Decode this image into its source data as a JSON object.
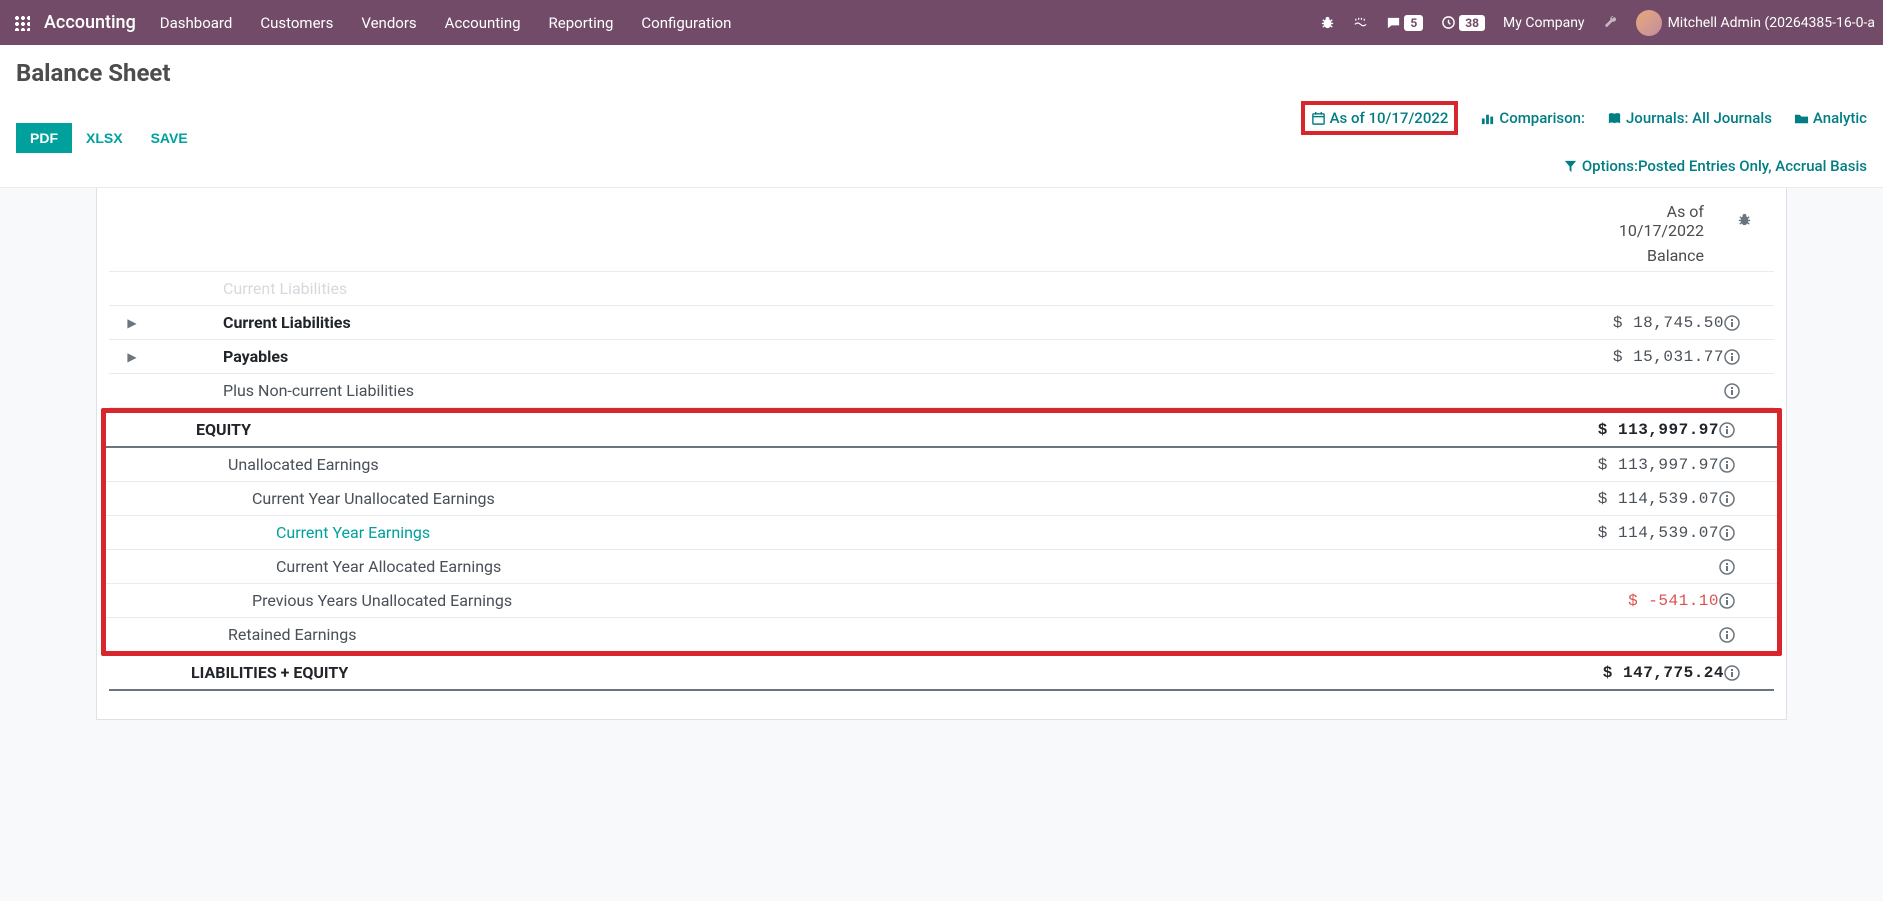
{
  "topbar": {
    "brand": "Accounting",
    "menu": [
      "Dashboard",
      "Customers",
      "Vendors",
      "Accounting",
      "Reporting",
      "Configuration"
    ],
    "msg_badge": "5",
    "clock_badge": "38",
    "company": "My Company",
    "user": "Mitchell Admin (20264385-16-0-a"
  },
  "page": {
    "title": "Balance Sheet",
    "buttons": {
      "pdf": "PDF",
      "xlsx": "XLSX",
      "save": "SAVE"
    },
    "filters": {
      "asof": "As of 10/17/2022",
      "comparison": "Comparison:",
      "journals": "Journals: All Journals",
      "analytic": "Analytic",
      "options": "Options:Posted Entries Only, Accrual Basis"
    }
  },
  "report": {
    "header_line1": "As of",
    "header_line2": "10/17/2022",
    "balance_label": "Balance",
    "rows": {
      "truncated": "Current Liabilities",
      "cur_liab_label": "Current Liabilities",
      "cur_liab_val": "$ 18,745.50",
      "payables_label": "Payables",
      "payables_val": "$ 15,031.77",
      "plus_nc": "Plus Non-current Liabilities",
      "equity_label": "EQUITY",
      "equity_val": "$ 113,997.97",
      "unalloc_label": "Unallocated Earnings",
      "unalloc_val": "$ 113,997.97",
      "cy_unalloc_label": "Current Year Unallocated Earnings",
      "cy_unalloc_val": "$ 114,539.07",
      "cy_earn_label": "Current Year Earnings",
      "cy_earn_val": "$ 114,539.07",
      "cy_alloc_label": "Current Year Allocated Earnings",
      "py_unalloc_label": "Previous Years Unallocated Earnings",
      "py_unalloc_val": "$ -541.10",
      "retained_label": "Retained Earnings",
      "liab_eq_label": "LIABILITIES + EQUITY",
      "liab_eq_val": "$ 147,775.24"
    }
  }
}
